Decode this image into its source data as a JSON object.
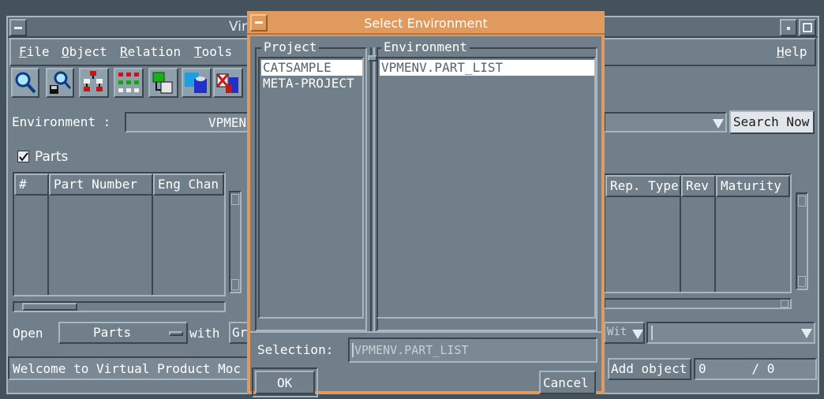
{
  "main": {
    "title": "Vir",
    "menu": [
      "File",
      "Object",
      "Relation",
      "Tools",
      "("
    ],
    "help": "Help",
    "env_label": "Environment :",
    "env_value": "VPMEN",
    "search_now": "Search Now",
    "parts_label": "Parts",
    "left_columns": [
      "#",
      "Part Number",
      "Eng Chan"
    ],
    "right_columns": [
      "Rep. Type",
      "Rev",
      "Maturity"
    ],
    "open_label": "Open",
    "open_option": "Parts",
    "with_label": "with",
    "gr_label": "Gr",
    "wit_label": "Wit",
    "status": "Welcome to Virtual Product Moc",
    "add_object": "Add object",
    "counter": "0      / 0"
  },
  "dialog": {
    "title": "Select Environment",
    "project_label": "Project",
    "environment_label": "Environment",
    "projects": [
      "CATSAMPLE",
      "META-PROJECT"
    ],
    "environments": [
      "VPMENV.PART_LIST"
    ],
    "selection_label": "Selection:",
    "selection_value": "VPMENV.PART_LIST",
    "ok": "OK",
    "cancel": "Cancel"
  },
  "colors": {
    "dialog_title_bg": "#e09a5e",
    "panel": "#707f8a",
    "selected": "#ffffff"
  }
}
